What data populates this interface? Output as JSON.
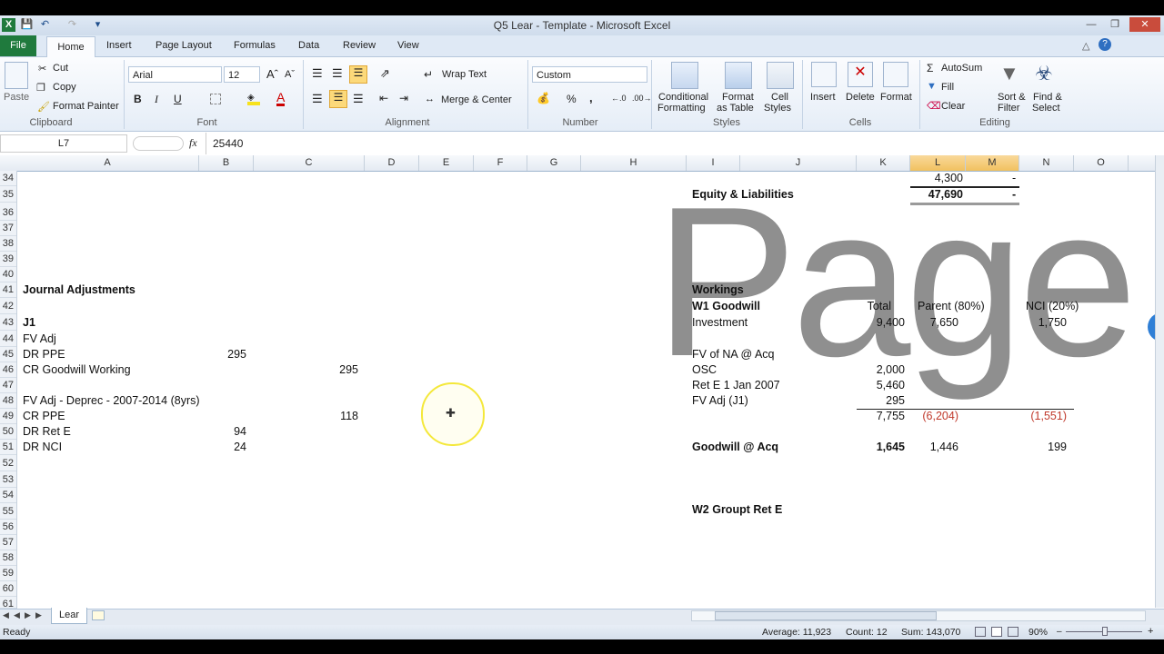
{
  "window": {
    "title": "Q5 Lear - Template  -  Microsoft Excel",
    "controls": {
      "minimize": "—",
      "restore": "❐",
      "close": "✕"
    }
  },
  "tabs": [
    "File",
    "Home",
    "Insert",
    "Page Layout",
    "Formulas",
    "Data",
    "Review",
    "View"
  ],
  "ribbon": {
    "clipboard": {
      "paste": "Paste",
      "cut": "Cut",
      "copy": "Copy",
      "format_painter": "Format Painter",
      "label": "Clipboard"
    },
    "font": {
      "name": "Arial",
      "size": "12",
      "bold": "B",
      "italic": "I",
      "underline": "U",
      "label": "Font"
    },
    "alignment": {
      "wrap": "Wrap Text",
      "merge": "Merge & Center",
      "label": "Alignment"
    },
    "number": {
      "format": "Custom",
      "percent": "%",
      "comma": ",",
      "label": "Number"
    },
    "styles": {
      "conditional1": "Conditional",
      "conditional2": "Formatting",
      "table1": "Format",
      "table2": "as Table",
      "cell1": "Cell",
      "cell2": "Styles",
      "label": "Styles"
    },
    "cells": {
      "insert": "Insert",
      "delete": "Delete",
      "format": "Format",
      "label": "Cells"
    },
    "editing": {
      "autosum": "AutoSum",
      "fill": "Fill",
      "clear": "Clear",
      "sort1": "Sort &",
      "sort2": "Filter",
      "find1": "Find &",
      "find2": "Select",
      "label": "Editing"
    }
  },
  "formula_bar": {
    "name_box": "L7",
    "fx": "fx",
    "value": "25440"
  },
  "columns": [
    "A",
    "B",
    "C",
    "D",
    "E",
    "F",
    "G",
    "H",
    "I",
    "J",
    "K",
    "L",
    "M",
    "N",
    "O"
  ],
  "rows": [
    "34",
    "35",
    "36",
    "37",
    "38",
    "39",
    "40",
    "41",
    "42",
    "43",
    "44",
    "45",
    "46",
    "47",
    "48",
    "49",
    "50",
    "51",
    "52",
    "53",
    "54",
    "55",
    "56",
    "57",
    "58",
    "59",
    "60",
    "61"
  ],
  "cells": {
    "equity_title": "Equity & Liabilities",
    "l34": "4,300",
    "m34": "-",
    "l35": "47,690",
    "m35": "-",
    "journal_title": "Journal Adjustments",
    "j1": "J1",
    "fv_adj": "FV Adj",
    "dr_ppe": "DR PPE",
    "dr_ppe_b": "295",
    "cr_gw": "CR Goodwill Working",
    "cr_gw_c": "295",
    "fv_deprec": "FV Adj - Deprec - 2007-2014 (8yrs)",
    "cr_ppe": "CR PPE",
    "cr_ppe_c": "118",
    "dr_rete": "DR Ret E",
    "dr_rete_b": "94",
    "dr_nci": "DR NCI",
    "dr_nci_b": "24",
    "workings": "Workings",
    "w1": "W1 Goodwill",
    "total_h": "Total",
    "parent_h": "Parent (80%)",
    "nci_h": "NCI (20%)",
    "investment": "Investment",
    "inv_total": "9,400",
    "inv_parent": "7,650",
    "inv_nci": "1,750",
    "fv_na": "FV of NA @ Acq",
    "osc": "OSC",
    "osc_v": "2,000",
    "rete": "Ret E 1 Jan 2007",
    "rete_v": "5,460",
    "fvadj_j1": "FV Adj (J1)",
    "fvadj_j1_v": "295",
    "sum_total": "7,755",
    "sum_parent": "(6,204)",
    "sum_nci": "(1,551)",
    "gw_acq": "Goodwill @ Acq",
    "gw_total": "1,645",
    "gw_parent": "1,446",
    "gw_nci": "199",
    "w2": "W2 Groupt Ret E"
  },
  "watermark": "Page",
  "sheet_tab": "Lear",
  "status": {
    "ready": "Ready",
    "average": "Average: 11,923",
    "count": "Count: 12",
    "sum": "Sum: 143,070",
    "zoom": "90%"
  },
  "colors": {
    "file_tab": "#1f7a3d",
    "selected_header": "#f1c15f",
    "negative": "#c0392b",
    "cursor_ring": "#f4e83a"
  }
}
